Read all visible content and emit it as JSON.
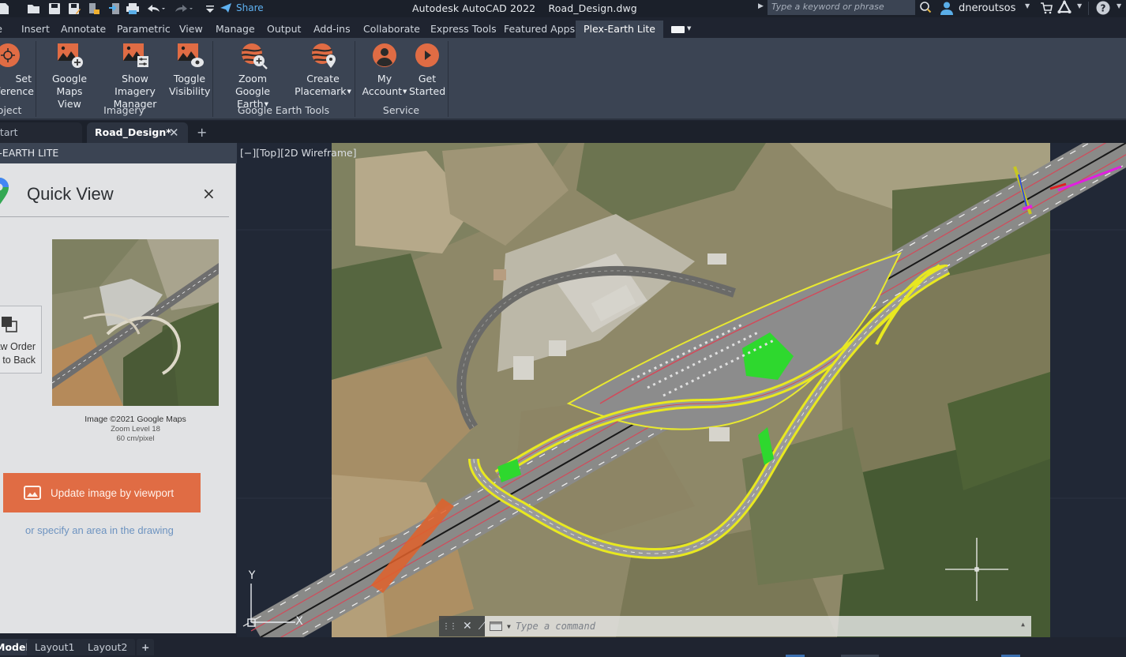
{
  "window": {
    "app_title": "Autodesk AutoCAD 2022",
    "file_name": "Road_Design.dwg"
  },
  "quick_access": {
    "icons": [
      "new-icon",
      "open-icon",
      "save-icon",
      "save-as-icon",
      "open-from-web-icon",
      "save-to-web-icon",
      "plot-icon",
      "undo-icon",
      "redo-icon",
      "customize-qat-icon"
    ],
    "share_label": "Share"
  },
  "search": {
    "placeholder": "Type a keyword or phrase"
  },
  "user": {
    "name": "dneroutsos"
  },
  "ribbon_tabs": [
    {
      "label": "Home"
    },
    {
      "label": "Insert"
    },
    {
      "label": "Annotate"
    },
    {
      "label": "Parametric"
    },
    {
      "label": "View"
    },
    {
      "label": "Manage"
    },
    {
      "label": "Output"
    },
    {
      "label": "Add-ins"
    },
    {
      "label": "Collaborate"
    },
    {
      "label": "Express Tools"
    },
    {
      "label": "Featured Apps"
    },
    {
      "label": "Plex-Earth Lite",
      "active": true
    }
  ],
  "ribbon": {
    "groups": [
      {
        "label": "Project",
        "buttons": [
          {
            "label_line1": "Set",
            "label_line2": "Reference",
            "icon": "georeference-icon"
          }
        ]
      },
      {
        "label": "Imagery",
        "buttons": [
          {
            "label_line1": "Google Maps",
            "label_line2": "View",
            "icon": "image-add-icon"
          },
          {
            "label_line1": "Show Imagery",
            "label_line2": "Manager",
            "icon": "image-settings-icon"
          },
          {
            "label_line1": "Toggle",
            "label_line2": "Visibility",
            "icon": "image-visibility-icon"
          }
        ]
      },
      {
        "label": "Google Earth Tools",
        "buttons": [
          {
            "label_line1": "Zoom",
            "label_line2": "Google Earth",
            "icon": "globe-zoom-icon",
            "dropdown": true
          },
          {
            "label_line1": "Create",
            "label_line2": "Placemark",
            "icon": "globe-placemark-icon",
            "dropdown": true
          }
        ]
      },
      {
        "label": "Service",
        "buttons": [
          {
            "label_line1": "My",
            "label_line2": "Account",
            "icon": "account-icon",
            "dropdown": true
          },
          {
            "label_line1": "Get",
            "label_line2": "Started",
            "icon": "play-icon"
          }
        ]
      }
    ]
  },
  "doc_tabs": [
    {
      "label": "Start"
    },
    {
      "label": "Road_Design*",
      "active": true
    }
  ],
  "palette": {
    "header": "PLEX-EARTH LITE",
    "title": "Quick View",
    "draw_order_line1": "Draw Order:",
    "draw_order_line2": "Send to Back",
    "image_credit": "Image ©2021 Google Maps",
    "zoom_level": "Zoom Level 18",
    "resolution": "60 cm/pixel",
    "update_button": "Update image by viewport",
    "specify_link": "or specify an area in the drawing"
  },
  "viewport": {
    "label": "[−][Top][2D Wireframe]",
    "ucs_y": "Y",
    "ucs_x": "X"
  },
  "command_line": {
    "placeholder": "Type a command"
  },
  "layout_tabs": [
    {
      "label": "Model",
      "active": true
    },
    {
      "label": "Layout1"
    },
    {
      "label": "Layout2"
    }
  ],
  "colors": {
    "accent_orange": "#e06c44",
    "ribbon_bg": "#3b4453",
    "titlebar_bg": "#1b202a",
    "link_blue": "#6d93c0",
    "share_blue": "#5fb2f2"
  }
}
